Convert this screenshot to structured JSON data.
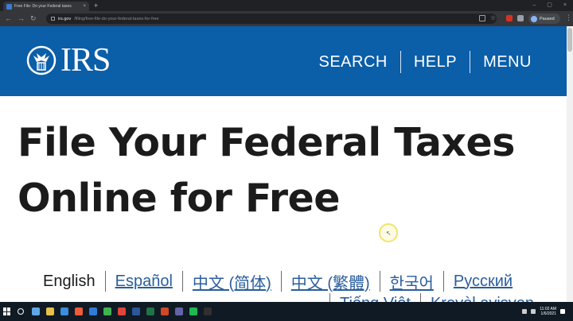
{
  "browser": {
    "tab_title": "Free File: Do your Federal taxes",
    "tab_close": "×",
    "new_tab": "+",
    "window_controls": [
      "–",
      "▢",
      "×"
    ],
    "url_host": "irs.gov",
    "url_path": "/filing/free-file-do-your-federal-taxes-for-free",
    "nav_back": "←",
    "nav_forward": "→",
    "nav_reload": "↻",
    "profile_label": "Paused",
    "menu": "⋮",
    "icons": [
      "chrome-tab-favicon",
      "lock-icon",
      "share-icon",
      "star-icon",
      "extension-icon",
      "puzzle-icon"
    ]
  },
  "header": {
    "logo_text": "IRS",
    "nav": [
      "SEARCH",
      "HELP",
      "MENU"
    ],
    "colors": {
      "background": "#0b5ea8",
      "text": "#ffffff"
    }
  },
  "main": {
    "title_line1": "File Your Federal Taxes",
    "title_line2": "Online for Free",
    "languages": [
      {
        "label": "English",
        "link": false
      },
      {
        "label": "Español",
        "link": true
      },
      {
        "label": "中文 (简体)",
        "link": true
      },
      {
        "label": "中文 (繁體)",
        "link": true
      },
      {
        "label": "한국어",
        "link": true
      },
      {
        "label": "Русский",
        "link": true
      },
      {
        "label": "Tiếng Việt",
        "link": true
      },
      {
        "label": "Kreyòl ayisyen",
        "link": true
      }
    ]
  },
  "taskbar": {
    "icons": [
      "start-icon",
      "search-icon",
      "task-view-icon",
      "edge-icon",
      "explorer-icon",
      "store-icon",
      "mail-icon",
      "chrome-icon",
      "word-icon",
      "excel-icon",
      "powerpoint-icon",
      "teams-icon",
      "spotify-icon",
      "obs-icon",
      "vlc-icon"
    ],
    "icon_colors": [
      "#5fa8e8",
      "#e7c04a",
      "#3c8ddb",
      "#ef5b3a",
      "#2f7bd6",
      "#3fb34f",
      "#e0443a",
      "#2b579a",
      "#217346",
      "#d24726",
      "#6264a7",
      "#1db954",
      "#303030",
      "#f08a24"
    ],
    "clock_time": "11:02 AM",
    "clock_date": "1/6/2021"
  }
}
